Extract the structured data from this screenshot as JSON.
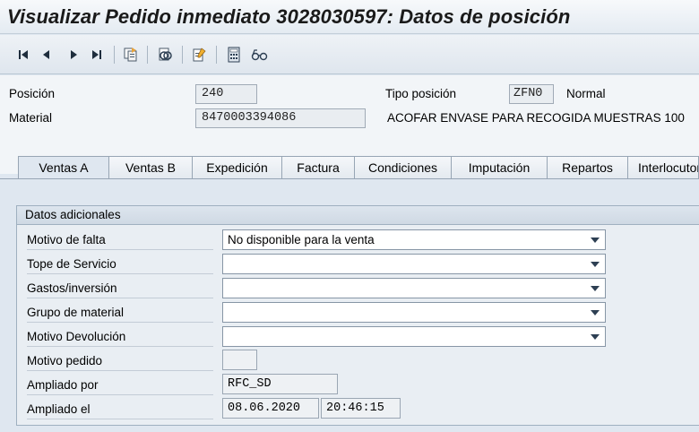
{
  "window": {
    "title": "Visualizar Pedido inmediato 3028030597: Datos de posición"
  },
  "toolbar": {
    "icons": [
      "first-page-icon",
      "previous-page-icon",
      "next-page-icon",
      "last-page-icon",
      "document-copy-icon",
      "display-object-icon",
      "edit-document-icon",
      "calculator-icon",
      "glasses-icon"
    ]
  },
  "header": {
    "posicion_label": "Posición",
    "posicion_value": "240",
    "material_label": "Material",
    "material_value": "8470003394086",
    "tipo_posicion_label": "Tipo posición",
    "tipo_posicion_value": "ZFN0",
    "tipo_posicion_text": "Normal",
    "material_description": "ACOFAR ENVASE PARA RECOGIDA MUESTRAS 100"
  },
  "tabs": [
    {
      "label": "Ventas A",
      "active": true
    },
    {
      "label": "Ventas B",
      "active": false
    },
    {
      "label": "Expedición",
      "active": false
    },
    {
      "label": "Factura",
      "active": false
    },
    {
      "label": "Condiciones",
      "active": false
    },
    {
      "label": "Imputación",
      "active": false
    },
    {
      "label": "Repartos",
      "active": false
    },
    {
      "label": "Interlocutores",
      "active": false
    }
  ],
  "group": {
    "title": "Datos adicionales",
    "motivo_falta_label": "Motivo de falta",
    "motivo_falta_value": "No disponible para la venta",
    "tope_servicio_label": "Tope de Servicio",
    "tope_servicio_value": "",
    "gastos_inversion_label": "Gastos/inversión",
    "gastos_inversion_value": "",
    "grupo_material_label": "Grupo de material",
    "grupo_material_value": "",
    "motivo_devolucion_label": "Motivo Devolución",
    "motivo_devolucion_value": "",
    "motivo_pedido_label": "Motivo pedido",
    "motivo_pedido_value": "",
    "ampliado_por_label": "Ampliado por",
    "ampliado_por_value": "RFC_SD",
    "ampliado_el_label": "Ampliado el",
    "ampliado_el_date": "08.06.2020",
    "ampliado_el_time": "20:46:15"
  },
  "colors": {
    "accent": "#2d3f53",
    "background": "#dfe7f0"
  }
}
